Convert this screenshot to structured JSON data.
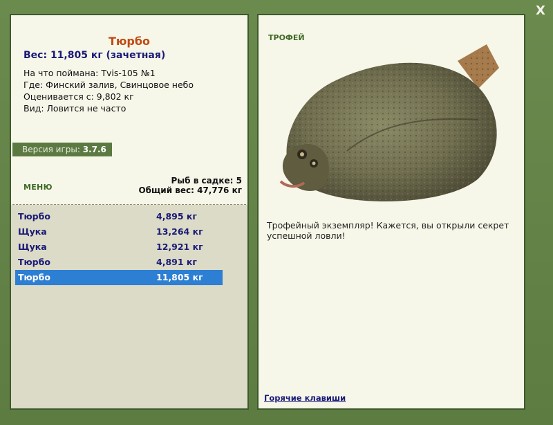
{
  "window": {
    "close_glyph": "X"
  },
  "fish": {
    "title": "Тюрбо",
    "weight_line": "Вес: 11,805 кг (зачетная)",
    "caught_on": "На что поймана: Tvis-105 №1",
    "location": "Где: Финский залив, Свинцовое небо",
    "estimated_from": "Оценивается с: 9,802 кг",
    "kind": "Вид: Ловится не часто"
  },
  "version": {
    "label": "Версия игры:",
    "value": "3.7.6"
  },
  "menu": {
    "label": "МЕНЮ"
  },
  "cage": {
    "count_line": "Рыб в садке: 5",
    "total_line": "Общий вес: 47,776 кг"
  },
  "catch_list": [
    {
      "name": "Тюрбо",
      "weight": "4,895 кг"
    },
    {
      "name": "Щука",
      "weight": "13,264 кг"
    },
    {
      "name": "Щука",
      "weight": "12,921 кг"
    },
    {
      "name": "Тюрбо",
      "weight": "4,891 кг"
    },
    {
      "name": "Тюрбо",
      "weight": "11,805 кг"
    }
  ],
  "trophy": {
    "label": "ТРОФЕЙ",
    "description": "Трофейный экземпляр! Кажется, вы открыли секрет успешной ловли!"
  },
  "hotkeys": {
    "label": "Горячие клавиши"
  },
  "colors": {
    "accent": "#5b7a42",
    "selected": "#2d7fd4",
    "title": "#c04a10"
  }
}
